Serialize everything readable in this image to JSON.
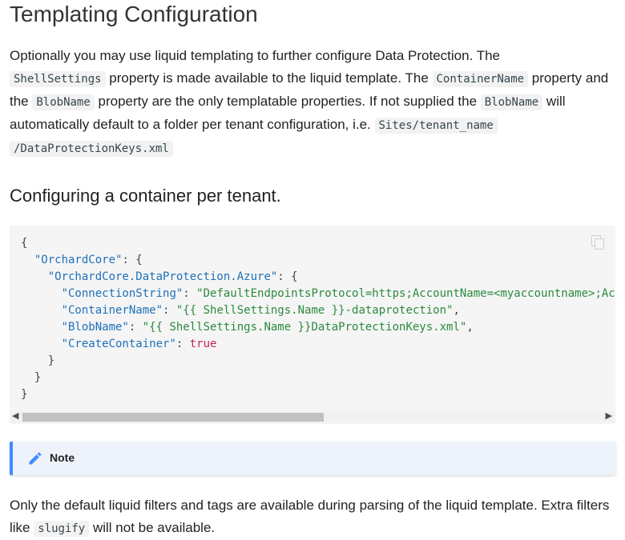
{
  "heading": "Templating Configuration",
  "intro": {
    "t1": "Optionally you may use liquid templating to further configure Data Protection. The",
    "c1": "ShellSettings",
    "t2": " property is made available to the liquid template. The ",
    "c2": "ContainerName",
    "t3": " property and the ",
    "c3": "BlobName",
    "t4": " property are the only templatable properties. If not supplied the ",
    "c4": "BlobName",
    "t5": " will automatically default to a folder per tenant configuration, i.e. ",
    "c5a": "Sites/tenant_name",
    "c5b": "/DataProtectionKeys.xml"
  },
  "subheading": "Configuring a container per tenant.",
  "code": {
    "open_brace": "{",
    "orchard_key": "\"OrchardCore\"",
    "azure_key": "\"OrchardCore.DataProtection.Azure\"",
    "conn_key": "\"ConnectionString\"",
    "conn_val": "\"DefaultEndpointsProtocol=https;AccountName=<myaccountname>;AccountKey=<myaccountkey>;EndpointSuffix=core.windows.net\"",
    "container_key": "\"ContainerName\"",
    "container_val": "\"{{ ShellSettings.Name }}-dataprotection\"",
    "blob_key": "\"BlobName\"",
    "blob_val": "\"{{ ShellSettings.Name }}DataProtectionKeys.xml\"",
    "create_key": "\"CreateContainer\"",
    "create_val": "true",
    "close_brace": "}",
    "copy_icon": "copy-icon"
  },
  "note": {
    "title": "Note",
    "icon": "pencil-icon",
    "accent": "#448aff"
  },
  "footer": {
    "t1": "Only the default liquid filters and tags are available during parsing of the liquid template. Extra filters like ",
    "c1": "slugify",
    "t2": " will not be available."
  }
}
